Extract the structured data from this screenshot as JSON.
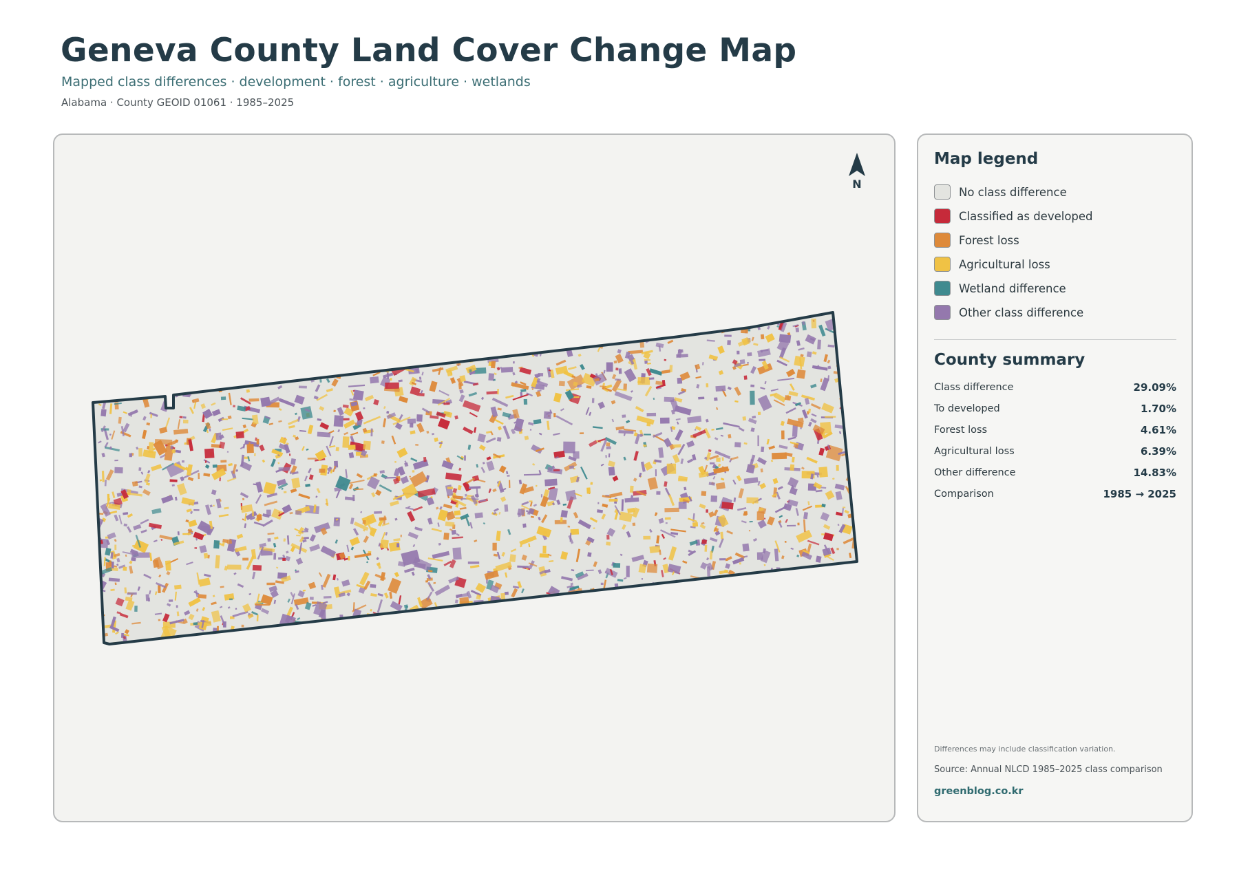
{
  "header": {
    "title": "Geneva County Land Cover Change Map",
    "subtitle": "Mapped class differences · development · forest · agriculture · wetlands",
    "meta": "Alabama · County GEOID 01061 · 1985–2025"
  },
  "map": {
    "north_label": "N",
    "base_color": "#e3e4e0",
    "outline_color": "#243b47"
  },
  "legend": {
    "title": "Map legend",
    "items": [
      {
        "label": "No class difference",
        "color": "#e3e4e0"
      },
      {
        "label": "Classified as developed",
        "color": "#c62a3a"
      },
      {
        "label": "Forest loss",
        "color": "#de8a3a"
      },
      {
        "label": "Agricultural loss",
        "color": "#f0c245"
      },
      {
        "label": "Wetland difference",
        "color": "#3f8a8f"
      },
      {
        "label": "Other class difference",
        "color": "#9478ad"
      }
    ]
  },
  "summary": {
    "title": "County summary",
    "rows": [
      {
        "label": "Class difference",
        "value": "29.09%"
      },
      {
        "label": "To developed",
        "value": "1.70%"
      },
      {
        "label": "Forest loss",
        "value": "4.61%"
      },
      {
        "label": "Agricultural loss",
        "value": "6.39%"
      },
      {
        "label": "Other difference",
        "value": "14.83%"
      },
      {
        "label": "Comparison",
        "value": "1985 → 2025"
      }
    ]
  },
  "footer": {
    "note": "Differences may include classification variation.",
    "source": "Source: Annual NLCD 1985–2025 class comparison",
    "brand": "greenblog.co.kr"
  }
}
